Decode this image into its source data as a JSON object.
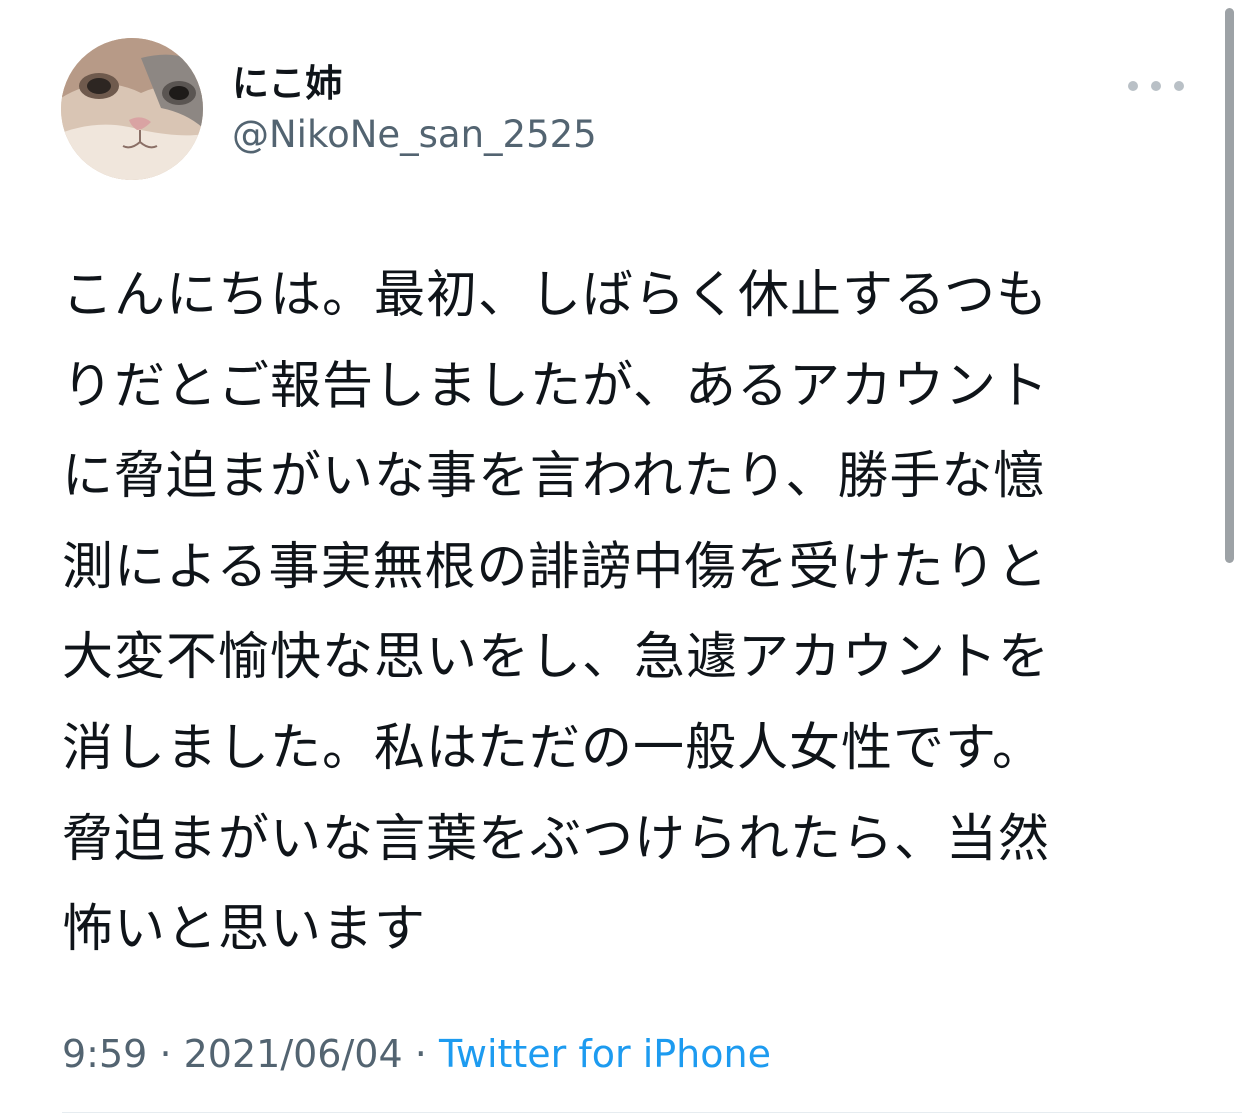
{
  "author": {
    "display_name": "にこ姉",
    "handle": "@NikoNe_san_2525"
  },
  "tweet": {
    "lines": [
      "こんにちは。最初、しばらく休止するつも",
      "りだとご報告しましたが、あるアカウント",
      "に脅迫まがいな事を言われたり、勝手な憶",
      "測による事実無根の誹謗中傷を受けたりと",
      "大変不愉快な思いをし、急遽アカウントを",
      "消しました。私はただの一般人女性です。",
      "脅迫まがいな言葉をぶつけられたら、当然",
      "怖いと思います"
    ]
  },
  "meta": {
    "time": "9:59",
    "separator": "·",
    "date": "2021/06/04",
    "source": "Twitter for iPhone"
  },
  "icons": {
    "avatar": "cat-avatar",
    "more": "more-options-icon"
  },
  "colors": {
    "text_primary": "#0f1419",
    "text_secondary": "#536471",
    "link": "#1d9bf0"
  }
}
